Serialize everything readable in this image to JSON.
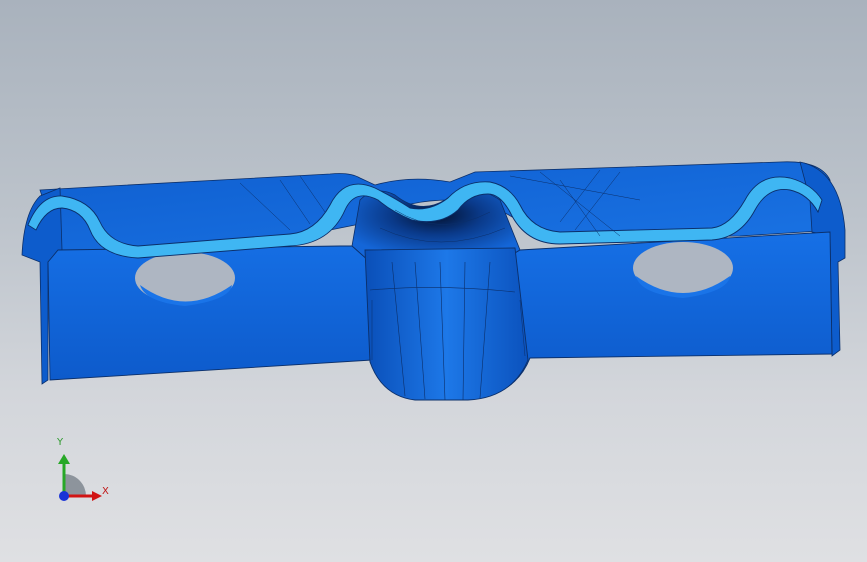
{
  "viewport": {
    "background_top": "#a9b2bd",
    "background_bottom": "#dfe0e3"
  },
  "model": {
    "body_color": "#1063d8",
    "body_dark": "#0a3f8f",
    "highlight_color": "#3fb6f3",
    "edge_color": "#0b2f6a"
  },
  "triad": {
    "x_label": "X",
    "y_label": "Y",
    "x_color": "#d11414",
    "y_color": "#27a827",
    "z_color": "#1a34d6"
  }
}
